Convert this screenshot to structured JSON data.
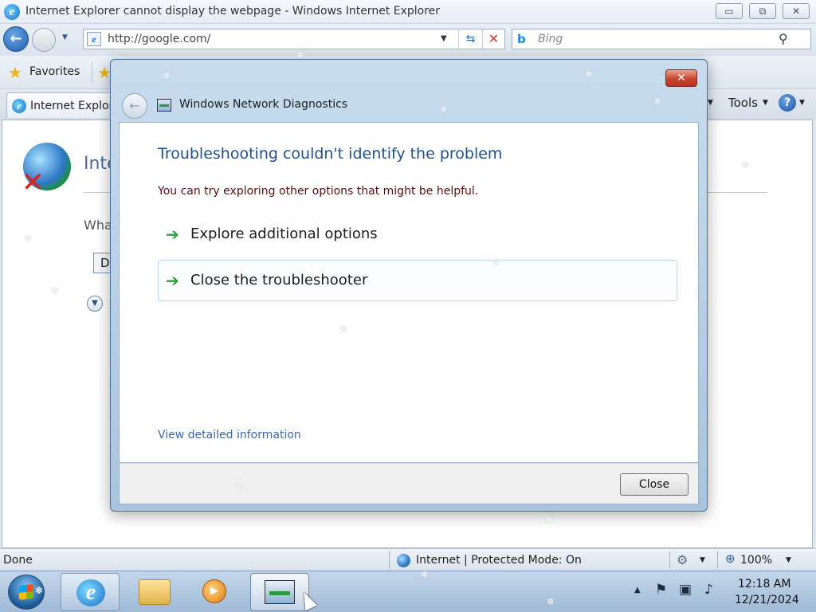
{
  "ie": {
    "window_title": "Internet Explorer cannot display the webpage - Windows Internet Explorer",
    "window_buttons": {
      "minimize": "▭",
      "restore": "⧉",
      "close": "✕"
    },
    "address": {
      "url": "http://google.com/"
    },
    "search": {
      "provider": "Bing",
      "placeholder": "Bing"
    },
    "favorites_label": "Favorites",
    "tab_title": "Internet Explore",
    "tools_label": "Tools",
    "page": {
      "heading_partial": "Inte",
      "question_partial": "Wha",
      "diagnose_button_partial": "D"
    },
    "status": {
      "left": "Done",
      "zone": "Internet | Protected Mode: On",
      "zoom": "100%"
    }
  },
  "dialog": {
    "title": "Windows Network Diagnostics",
    "heading": "Troubleshooting couldn't identify the problem",
    "subtitle": "You can try exploring other options that might be helpful.",
    "options": [
      {
        "label": "Explore additional options",
        "highlighted": false
      },
      {
        "label": "Close the troubleshooter",
        "highlighted": true
      }
    ],
    "details_link": "View detailed information",
    "close_button": "Close",
    "close_glyph": "✕"
  },
  "taskbar": {
    "clock_time": "12:18 AM",
    "clock_date": "12/21/2024"
  },
  "icons": {
    "back": "back-arrow-icon",
    "ie": "internet-explorer-icon",
    "bing": "bing-icon",
    "favorites": "star-icon",
    "help": "help-icon",
    "globe_error": "globe-error-icon",
    "option_arrow": "green-arrow-icon",
    "network_diagnostics": "network-diagnostics-icon"
  },
  "colors": {
    "dialog_heading": "#1f4f8f",
    "dialog_subtitle": "#5a0d0d",
    "option_arrow": "#2aa23b",
    "link": "#3a66a8",
    "close_red": "#c8462f"
  }
}
